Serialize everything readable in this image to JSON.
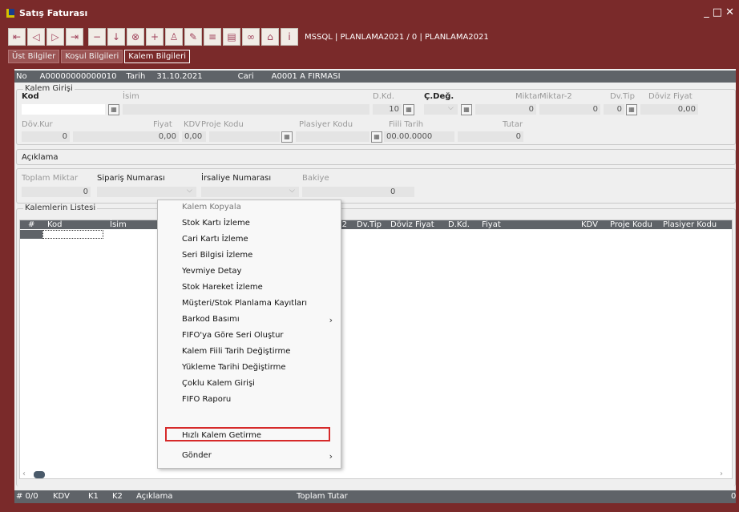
{
  "window": {
    "title": "Satış Faturası",
    "controls": [
      "_",
      "□",
      "✕"
    ]
  },
  "toolbar": {
    "connection": "MSSQL | PLANLAMA2021 / 0 | PLANLAMA2021"
  },
  "tabs": [
    "Üst Bilgiler",
    "Koşul Bilgileri",
    "Kalem Bilgileri"
  ],
  "header": {
    "no_label": "No",
    "no_value": "A00000000000010",
    "date_label": "Tarih",
    "date_value": "31.10.2021",
    "cari_label": "Cari",
    "cari_value": "A0001 A FIRMASI"
  },
  "kalem": {
    "title": "Kalem Girişi",
    "kod": "Kod",
    "isim": "İsim",
    "dkd": "D.Kd.",
    "cdeg": "Ç.Değ.",
    "miktar": "Miktar",
    "miktar2": "Miktar-2",
    "dvtip": "Dv.Tip",
    "doviz_fiyat": "Döviz Fiyat",
    "dkd_val": "10",
    "miktar_val": "0",
    "miktar2_val": "0",
    "dvtip_val": "0",
    "doviz_fiyat_val": "0,00",
    "dovkur": "Döv.Kur",
    "fiyat": "Fiyat",
    "kdv": "KDV",
    "proje": "Proje Kodu",
    "plasiyer": "Plasiyer Kodu",
    "fiili": "Fiili Tarih",
    "tutar": "Tutar",
    "dovkur_val": "0",
    "fiyat_val": "0,00",
    "kdv_val": "0,00",
    "fiili_val": "00.00.0000",
    "tutar_val": "0"
  },
  "aciklama": {
    "label": "Açıklama"
  },
  "ozet": {
    "toplam_miktar": "Toplam Miktar",
    "siparis": "Sipariş Numarası",
    "irsaliye": "İrsaliye Numarası",
    "bakiye": "Bakiye",
    "toplam_val": "0",
    "bakiye_val": "0"
  },
  "list": {
    "title": "Kalemlerin Listesi",
    "columns": [
      "#",
      "Kod",
      "İsim",
      "-2",
      "Dv.Tip",
      "Döviz Fiyat",
      "D.Kd.",
      "Fiyat",
      "KDV",
      "Proje Kodu",
      "Plasiyer Kodu"
    ]
  },
  "footer": {
    "count": "# 0/0",
    "kdv": "KDV",
    "k1": "K1",
    "k2": "K2",
    "aciklama": "Açıklama",
    "toplam": "Toplam Tutar",
    "toplam_val": "0"
  },
  "context_menu": {
    "items": [
      {
        "label": "Kalem Kopyala",
        "disabled": true
      },
      {
        "label": "Stok Kartı İzleme"
      },
      {
        "label": "Cari Kartı İzleme"
      },
      {
        "label": "Seri Bilgisi İzleme"
      },
      {
        "label": "Yevmiye Detay"
      },
      {
        "label": "Stok Hareket İzleme"
      },
      {
        "label": "Müşteri/Stok Planlama Kayıtları"
      },
      {
        "label": "Barkod Basımı",
        "submenu": true
      },
      {
        "label": "FIFO'ya Göre Seri Oluştur"
      },
      {
        "label": "Kalem Fiili Tarih Değiştirme"
      },
      {
        "label": "Yükleme Tarihi Değiştirme"
      },
      {
        "label": "Çoklu Kalem Girişi"
      },
      {
        "label": "FIFO Raporu"
      },
      {
        "label": "Hızlı Kalem Getirme",
        "highlighted": true
      },
      {
        "label": "Gönder",
        "submenu": true
      }
    ]
  }
}
